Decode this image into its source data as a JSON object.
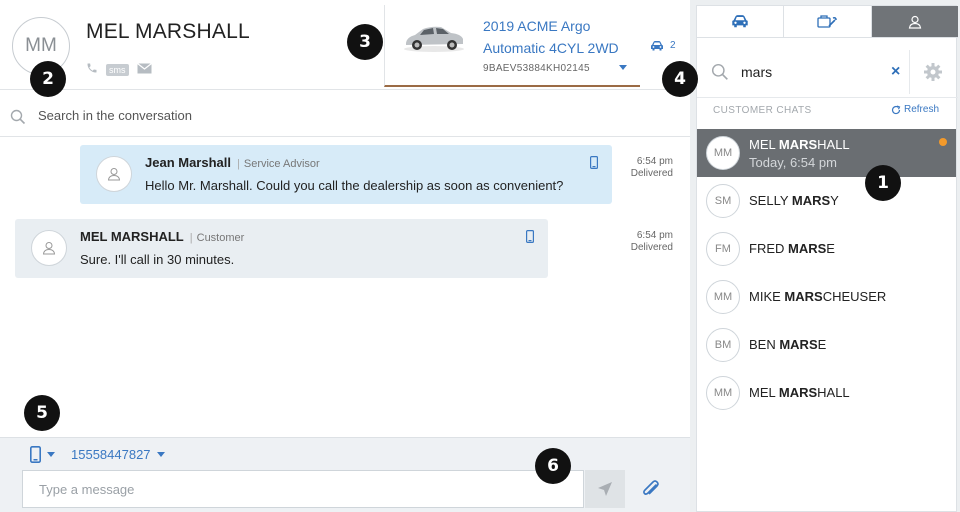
{
  "contact": {
    "initials": "MM",
    "name": "MEL MARSHALL",
    "sms_label": "sms"
  },
  "vehicle": {
    "title": "2019 ACME Argo Automatic 4CYL 2WD",
    "vin": "9BAEV53884KH02145",
    "count": "2"
  },
  "conversation_search": {
    "placeholder": "Search in the conversation"
  },
  "messages": [
    {
      "sender": "Jean Marshall",
      "role": "Service Advisor",
      "text": "Hello Mr. Marshall. Could you call the dealership as soon as convenient?",
      "time": "6:54 pm",
      "status": "Delivered"
    },
    {
      "sender": "MEL MARSHALL",
      "role": "Customer",
      "text": "Sure. I'll call in 30 minutes.",
      "time": "6:54 pm",
      "status": "Delivered"
    }
  ],
  "composer": {
    "from_number": "15558447827",
    "placeholder": "Type a message"
  },
  "callouts": [
    "1",
    "2",
    "3",
    "4",
    "5",
    "6"
  ],
  "right_panel": {
    "search_value": "mars",
    "section_label": "CUSTOMER CHATS",
    "refresh_label": "Refresh",
    "chats": [
      {
        "initials": "MM",
        "name_bold": "MARS",
        "name_pre": "MEL ",
        "name_post": "HALL",
        "time": "Today, 6:54 pm"
      },
      {
        "initials": "SM",
        "name_bold": "MARS",
        "name_pre": "SELLY ",
        "name_post": "Y"
      },
      {
        "initials": "FM",
        "name_bold": "MARS",
        "name_pre": "FRED ",
        "name_post": "E"
      },
      {
        "initials": "MM",
        "name_bold": "MARS",
        "name_pre": "MIKE ",
        "name_post": "CHEUSER"
      },
      {
        "initials": "BM",
        "name_bold": "MARS",
        "name_pre": "BEN ",
        "name_post": "E"
      },
      {
        "initials": "MM",
        "name_bold": "MARS",
        "name_pre": "MEL ",
        "name_post": "HALL"
      }
    ]
  },
  "colors": {
    "accent": "#3a78c2",
    "selected_row": "#6a6e72",
    "unread": "#f39a2b",
    "outbound_bubble": "#d7ebf8",
    "inbound_bubble": "#e9eef2"
  },
  "icons": [
    "phone-icon",
    "email-icon",
    "car-icon",
    "search-icon",
    "person-icon",
    "mobile-icon",
    "send-icon",
    "paperclip-icon",
    "gear-icon",
    "refresh-icon",
    "service-icon",
    "close-icon"
  ]
}
